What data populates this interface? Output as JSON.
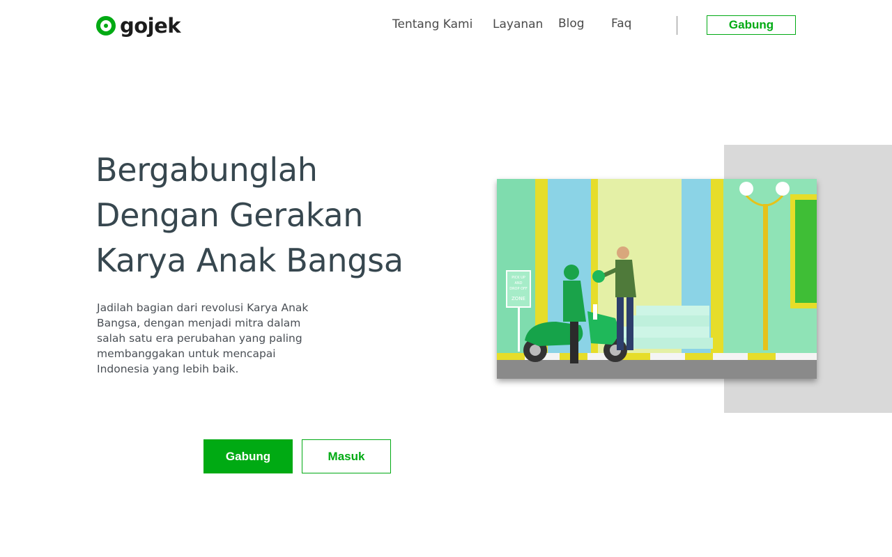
{
  "brand": {
    "name": "gojek",
    "color": "#00aa13"
  },
  "nav": {
    "items": [
      "Tentang Kami",
      "Layanan",
      "Blog",
      "Faq"
    ],
    "cta_label": "Gabung"
  },
  "hero": {
    "title_lines": [
      "Bergabunglah",
      "Dengan Gerakan",
      "Karya Anak Bangsa"
    ],
    "description": "Jadilah bagian dari revolusi Karya Anak Bangsa, dengan menjadi mitra dalam salah satu era perubahan yang paling membanggakan untuk mencapai Indonesia yang lebih baik.",
    "primary_button": "Gabung",
    "secondary_button": "Masuk"
  },
  "illustration": {
    "sign_lines": [
      "PICK UP",
      "AND",
      "DROP OFF",
      "ZONE"
    ]
  }
}
